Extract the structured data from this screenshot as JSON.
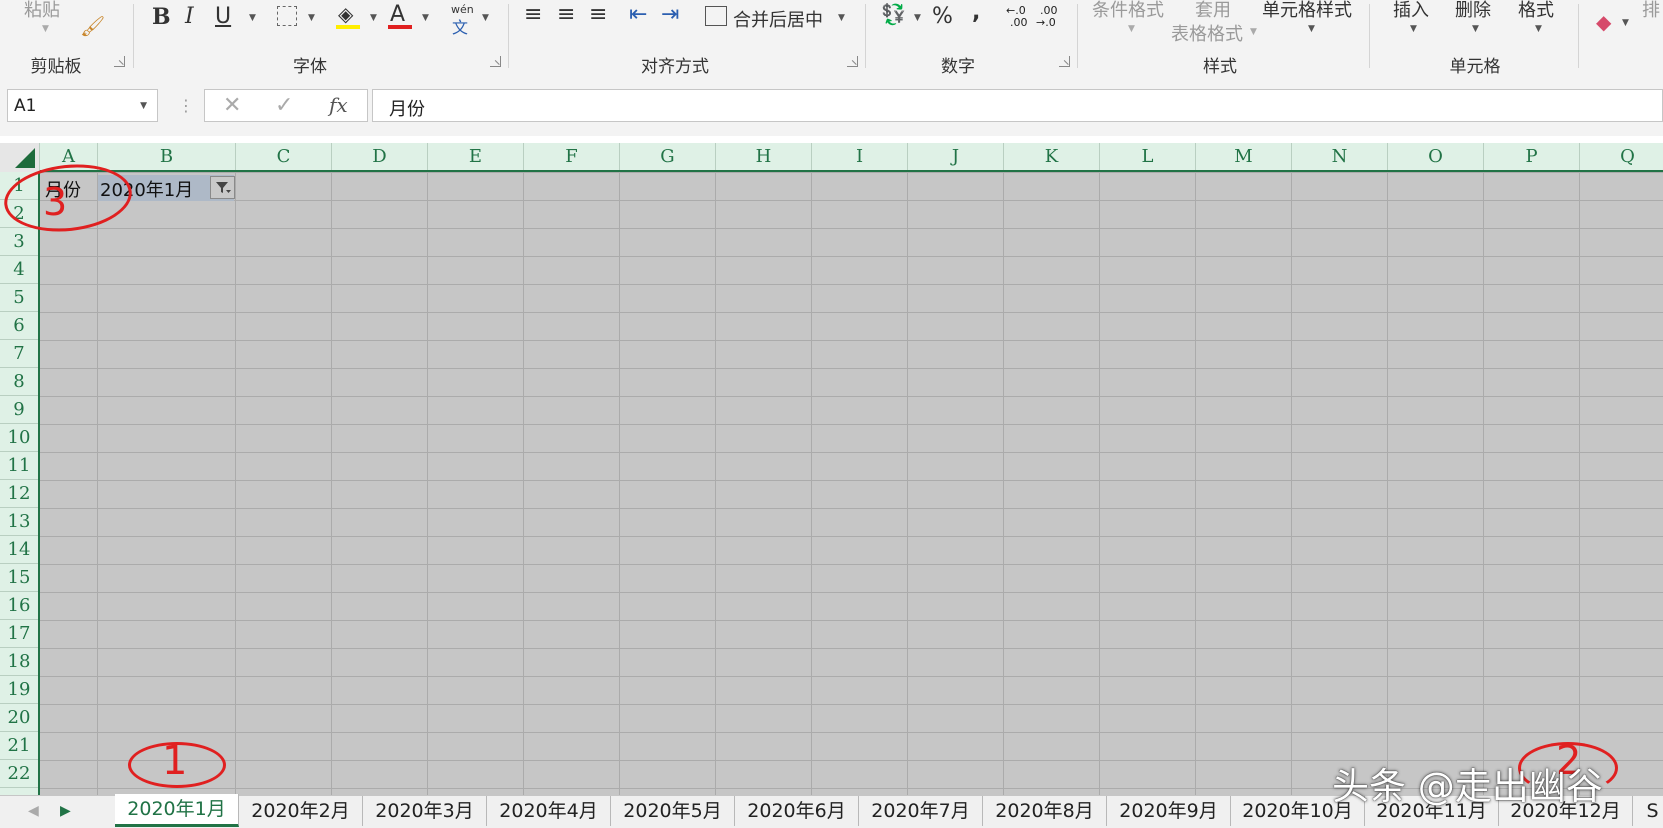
{
  "ribbon": {
    "clipboard": {
      "paste": "粘贴",
      "group": "剪贴板"
    },
    "font": {
      "bold": "B",
      "italic": "I",
      "underline": "U",
      "font_color_glyph": "A",
      "phonetic_top": "wén",
      "phonetic_bottom": "文",
      "group": "字体"
    },
    "alignment": {
      "merge_center": "合并后居中",
      "group": "对齐方式"
    },
    "number": {
      "percent": "%",
      "comma": ",",
      "inc_decimal_top": "←.0",
      "inc_decimal_bottom": ".00",
      "dec_decimal_top": ".00",
      "dec_decimal_bottom": "→.0",
      "group": "数字"
    },
    "styles": {
      "conditional": "条件格式",
      "table_top": "套用",
      "table_bottom": "表格格式",
      "cell_styles": "单元格样式",
      "group": "样式"
    },
    "cells": {
      "insert": "插入",
      "delete": "删除",
      "format": "格式",
      "group": "单元格"
    },
    "edit": {
      "sort_partial": "排"
    }
  },
  "formula_bar": {
    "name_box": "A1",
    "cancel": "✕",
    "enter": "✓",
    "fx": "fx",
    "content": "月份"
  },
  "columns": [
    "A",
    "B",
    "C",
    "D",
    "E",
    "F",
    "G",
    "H",
    "I",
    "J",
    "K",
    "L",
    "M",
    "N",
    "O",
    "P",
    "Q"
  ],
  "rows": [
    "1",
    "2",
    "3",
    "4",
    "5",
    "6",
    "7",
    "8",
    "9",
    "10",
    "11",
    "12",
    "13",
    "14",
    "15",
    "16",
    "17",
    "18",
    "19",
    "20",
    "21",
    "22"
  ],
  "cells": {
    "A1": "月份",
    "B1": "2020年1月"
  },
  "sheet_tabs": [
    "2020年1月",
    "2020年2月",
    "2020年3月",
    "2020年4月",
    "2020年5月",
    "2020年6月",
    "2020年7月",
    "2020年8月",
    "2020年9月",
    "2020年10月",
    "2020年11月",
    "2020年12月",
    "S"
  ],
  "active_sheet": "2020年1月",
  "annotations": {
    "n1": "1",
    "n2": "2",
    "n3": "3"
  },
  "watermark": "头条 @走出幽谷",
  "colors": {
    "accent": "#217346",
    "annotation": "#e02020"
  }
}
